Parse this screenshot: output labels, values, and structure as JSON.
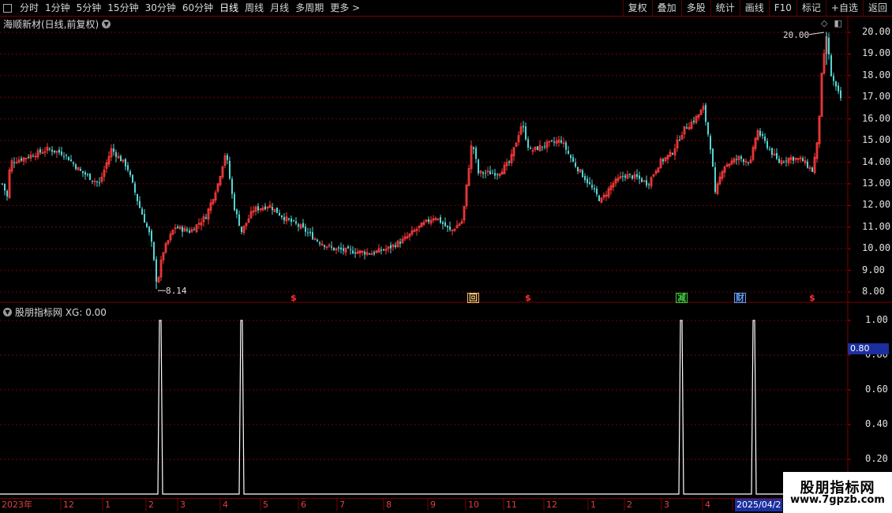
{
  "toolbar": {
    "periods": [
      "分时",
      "1分钟",
      "5分钟",
      "15分钟",
      "30分钟",
      "60分钟",
      "日线",
      "周线",
      "月线",
      "多周期",
      "更多 >"
    ],
    "active_period": "日线",
    "right_buttons": [
      "复权",
      "叠加",
      "多股",
      "统计",
      "画线",
      "F10",
      "标记",
      "+自选",
      "返回"
    ]
  },
  "main_chart": {
    "title": "海顺新材(日线,前复权)",
    "price_axis": [
      "20.00",
      "19.00",
      "18.00",
      "17.00",
      "16.00",
      "15.00",
      "14.00",
      "13.00",
      "12.00",
      "11.00",
      "10.00",
      "9.00",
      "8.00"
    ],
    "high_annotation": "20.00",
    "low_annotation": "8.14",
    "markers": [
      {
        "text": "$",
        "kind": "plain",
        "color": "#ff3030"
      },
      {
        "text": "回",
        "kind": "box",
        "color": "#f0c070"
      },
      {
        "text": "$",
        "kind": "plain",
        "color": "#ff3030"
      },
      {
        "text": "减",
        "kind": "box",
        "color": "#40d040"
      },
      {
        "text": "财",
        "kind": "box",
        "color": "#60a0ff"
      },
      {
        "text": "$",
        "kind": "plain",
        "color": "#ff3030"
      }
    ],
    "colors": {
      "up": "#ff3b3b",
      "down": "#54d6d6",
      "grid": "#7a0000"
    }
  },
  "indicator": {
    "title": "股朋指标网 XG: 0.00",
    "axis": [
      "1.00",
      "0.80",
      "0.60",
      "0.40",
      "0.20"
    ],
    "cursor_value": "0.80",
    "signal_value": 1,
    "line_color": "#ffffff"
  },
  "date_axis": {
    "ticks": [
      "2023年",
      "12",
      "1",
      "2",
      "3",
      "4",
      "5",
      "6",
      "7",
      "8",
      "9",
      "10",
      "11",
      "12",
      "1",
      "2",
      "3",
      "4",
      "2025/04/2"
    ],
    "current": "2025/04/2"
  },
  "watermark": {
    "line1": "股朋指标网",
    "line2": "www.7gpzb.com"
  }
}
